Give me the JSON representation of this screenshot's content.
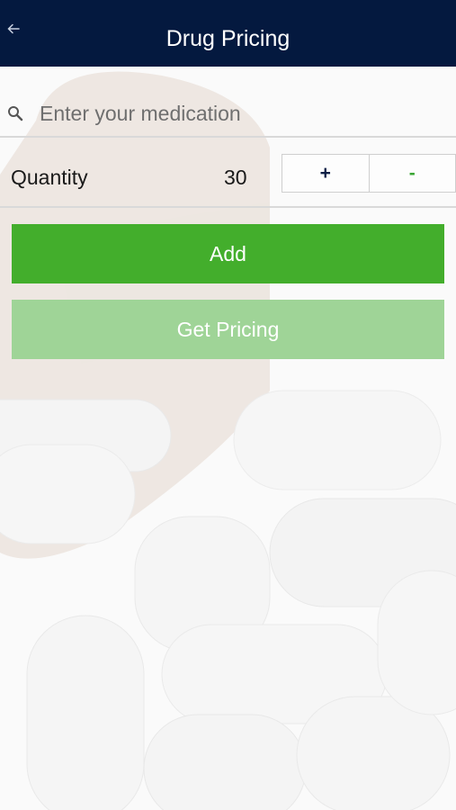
{
  "header": {
    "title": "Drug Pricing",
    "back_icon": "arrow-left-icon",
    "background_color": "#04193f"
  },
  "search": {
    "placeholder": "Enter your medication",
    "value": "",
    "icon": "search-icon"
  },
  "quantity": {
    "label": "Quantity",
    "value": "30",
    "increment_label": "+",
    "decrement_label": "-"
  },
  "actions": {
    "add_label": "Add",
    "get_pricing_label": "Get Pricing",
    "add_color": "#43ae2c",
    "get_pricing_color": "#9fd497"
  }
}
